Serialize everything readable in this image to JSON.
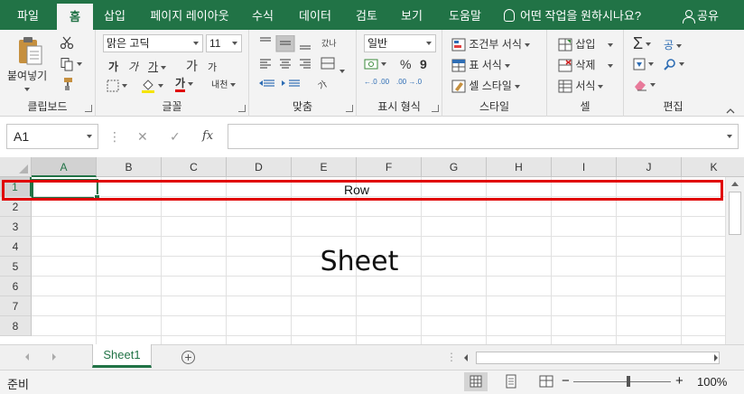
{
  "tabs": [
    {
      "label": "파일",
      "active": false
    },
    {
      "label": "홈",
      "active": true
    },
    {
      "label": "삽입",
      "active": false
    },
    {
      "label": "페이지 레이아웃",
      "active": false
    },
    {
      "label": "수식",
      "active": false
    },
    {
      "label": "데이터",
      "active": false
    },
    {
      "label": "검토",
      "active": false
    },
    {
      "label": "보기",
      "active": false
    },
    {
      "label": "도움말",
      "active": false
    }
  ],
  "tell_me": "어떤 작업을 원하시나요?",
  "share": "공유",
  "ribbon": {
    "clipboard": {
      "label": "클립보드",
      "paste": "붙여넣기"
    },
    "font": {
      "label": "글꼴",
      "name": "맑은 고딕",
      "size": "11",
      "bold": "가",
      "italic": "가",
      "underline": "가",
      "grow": "가",
      "shrink": "가",
      "color_letter": "가",
      "phonetic": "내천"
    },
    "alignment": {
      "label": "맞춤",
      "wrap": "갔나",
      "orient": "가"
    },
    "number": {
      "label": "표시 형식",
      "format": "일반",
      "percent": "%",
      "comma": "9",
      "inc": "←.0 .00",
      "dec": ".00 →.0"
    },
    "styles": {
      "label": "스타일",
      "conditional": "조건부 서식",
      "table": "표 서식",
      "cell": "셀 스타일"
    },
    "cells": {
      "label": "셀",
      "insert": "삽입",
      "delete": "삭제",
      "format": "서식"
    },
    "editing": {
      "label": "편집",
      "sort": "공"
    }
  },
  "formula_bar": {
    "name_box": "A1",
    "cancel": "✕",
    "enter": "✓",
    "fx": "fx",
    "value": ""
  },
  "columns": [
    "A",
    "B",
    "C",
    "D",
    "E",
    "F",
    "G",
    "H",
    "I",
    "J",
    "K"
  ],
  "rows": [
    "1",
    "2",
    "3",
    "4",
    "5",
    "6",
    "7",
    "8"
  ],
  "selected_cell": "A1",
  "annotations": {
    "row": "Row",
    "sheet": "Sheet"
  },
  "sheet_tabs": [
    {
      "label": "Sheet1",
      "active": true
    }
  ],
  "add_sheet": "+",
  "status": {
    "ready": "준비",
    "zoom_minus": "−",
    "zoom_plus": "+",
    "zoom": "100%",
    "zoom_level_percent": 100
  },
  "colors": {
    "accent": "#217346",
    "highlight_border": "#e00000"
  }
}
